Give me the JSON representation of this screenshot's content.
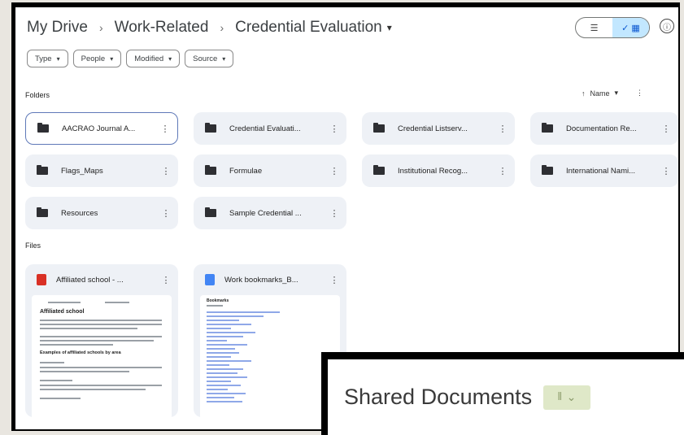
{
  "breadcrumb": {
    "items": [
      "My Drive",
      "Work-Related",
      "Credential Evaluation"
    ],
    "separator": "›",
    "caret": "▾"
  },
  "view_toggle": {
    "list_icon": "☰",
    "grid_icon": "✓ ▦"
  },
  "info_icon": "ⓘ",
  "filters": [
    {
      "label": "Type"
    },
    {
      "label": "People"
    },
    {
      "label": "Modified"
    },
    {
      "label": "Source"
    }
  ],
  "filter_caret": "▾",
  "folders_label": "Folders",
  "sort": {
    "arrow": "↑",
    "label": "Name",
    "caret": "▾",
    "kebab": "⋮"
  },
  "folders": [
    {
      "name": "AACRAO Journal A..."
    },
    {
      "name": "Credential Evaluati..."
    },
    {
      "name": "Credential Listserv..."
    },
    {
      "name": "Documentation Re..."
    },
    {
      "name": "Flags_Maps"
    },
    {
      "name": "Formulae"
    },
    {
      "name": "Institutional Recog..."
    },
    {
      "name": "International Nami..."
    },
    {
      "name": "Resources"
    },
    {
      "name": "Sample Credential ..."
    }
  ],
  "files_label": "Files",
  "files": [
    {
      "name": "Affiliated school - ...",
      "icon": "pdf-icon",
      "icon_color": "#d93025",
      "preview_heading": "Affiliated school",
      "preview_subheading": "Examples of affiliated schools by area"
    },
    {
      "name": "Work bookmarks_B...",
      "icon": "google-doc-icon",
      "icon_color": "#4285f4",
      "preview_heading": "Bookmarks"
    }
  ],
  "kebab": "⋮",
  "overlay": {
    "title": "Shared Documents",
    "button_icon": "library-icon",
    "button_glyph": "𝍪",
    "button_caret": "⌄"
  },
  "colors": {
    "selected_border": "#5f79b8",
    "tile_bg": "#eef1f6",
    "toggle_active": "#c2e7ff",
    "overlay_button": "#dfe8c8"
  }
}
